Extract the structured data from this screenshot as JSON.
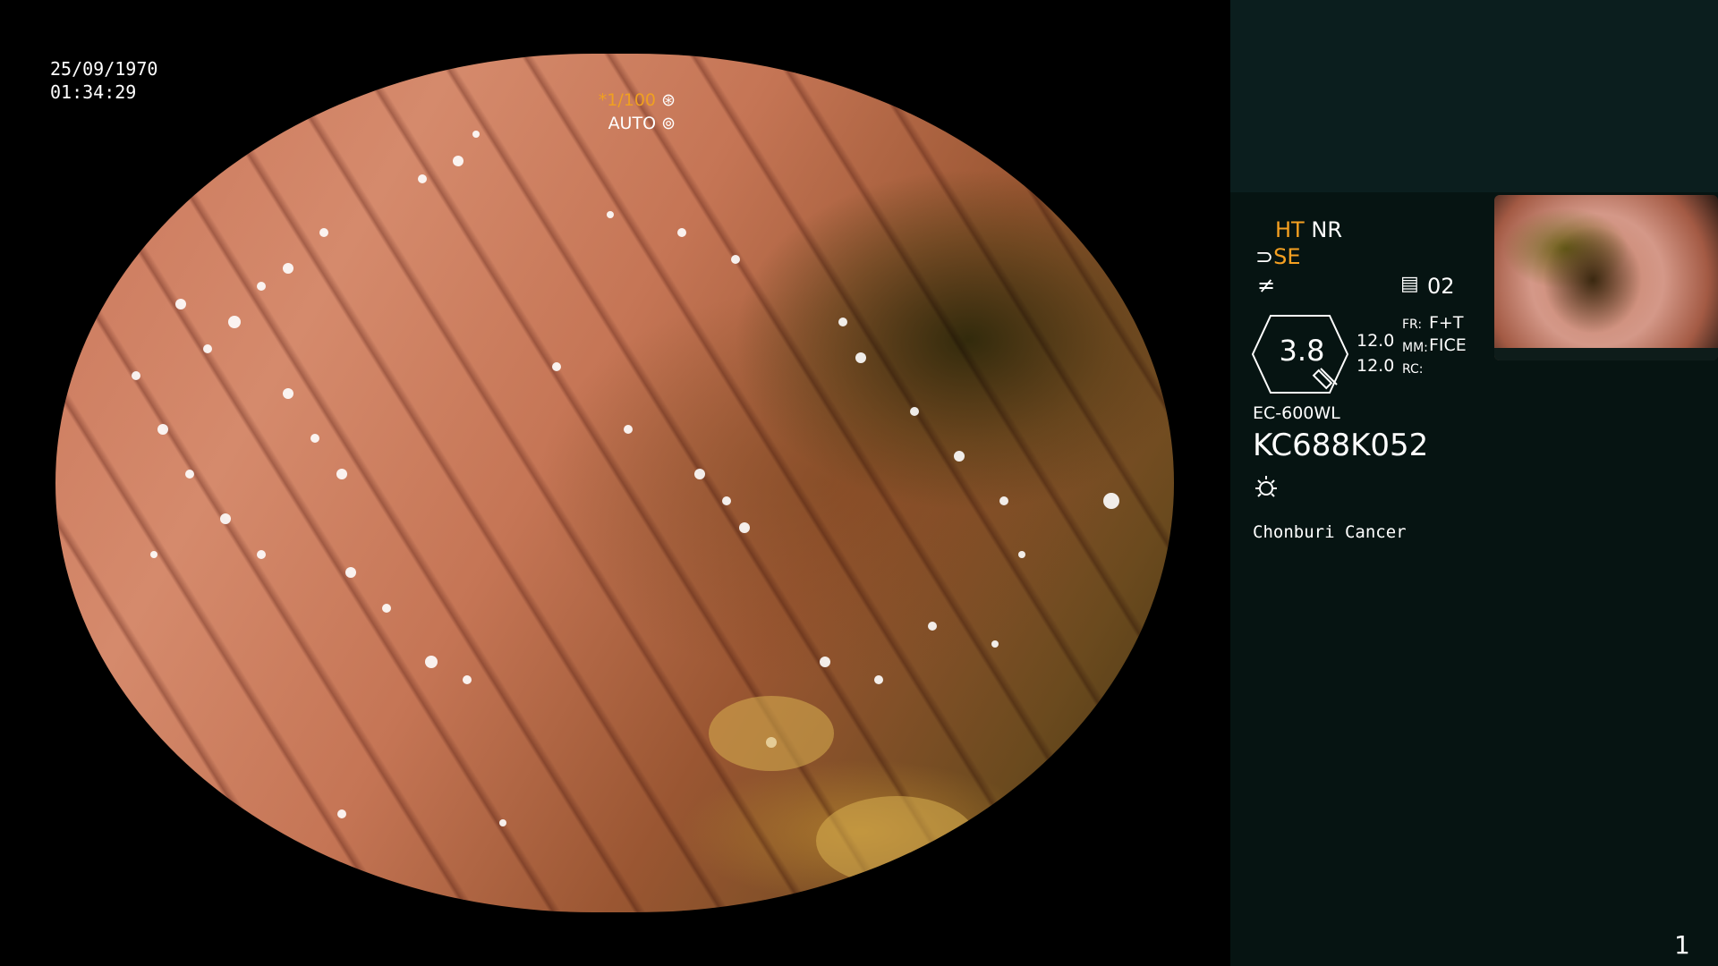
{
  "osd": {
    "date": "25/09/1970",
    "time": "01:34:29",
    "shutter_prefix": "*",
    "shutter_value": "1/100",
    "exposure": "AUTO"
  },
  "panel": {
    "ht_label": "HT",
    "nr_label": "NR",
    "se_label": "SE",
    "mode_number": "02",
    "zoom_value": "3.8",
    "value_1": "12.0",
    "value_2": "12.0",
    "fr_label": "FR:",
    "fr_value": "F+T",
    "mm_label": "MM:",
    "mm_value": "FICE",
    "rc_label": "RC:",
    "scope_model": "EC-600WL",
    "serial": "KC688K052",
    "hospital": "Chonburi Cancer",
    "page_number": "1"
  },
  "icons": [
    "shutter-icon",
    "auto-exposure-icon",
    "se-icon",
    "eq-icon",
    "mode-icon",
    "light-icon"
  ],
  "colors": {
    "accent_orange": "#f5a021",
    "panel_bg": "#061412",
    "panel_top_bg": "#0b1e1e"
  }
}
